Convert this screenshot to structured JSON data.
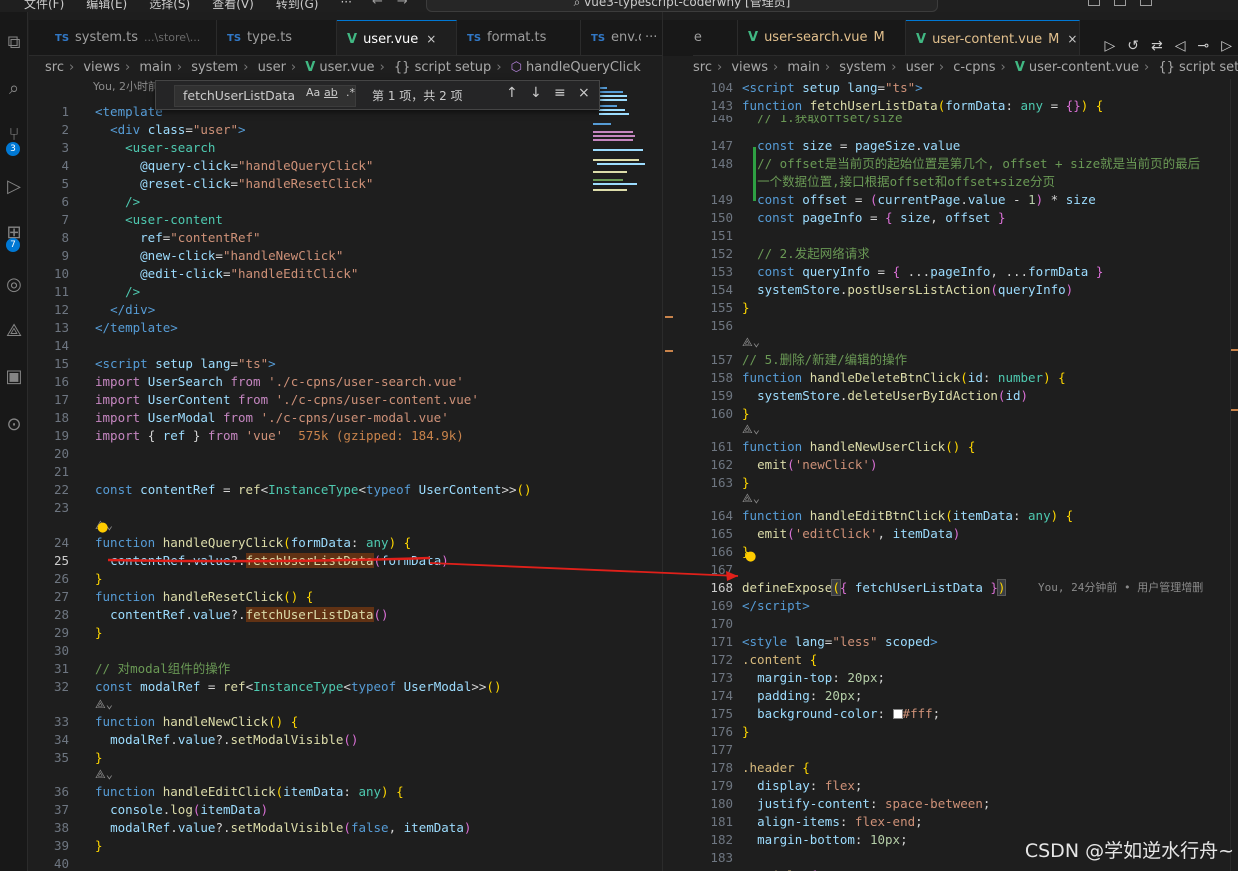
{
  "titlebar": {
    "menu": [
      "文件(F)",
      "编辑(E)",
      "选择(S)",
      "查看(V)",
      "转到(G)",
      "···"
    ],
    "command_center": "vue3-typescript-coderwhy [管理员]"
  },
  "left": {
    "tabs": [
      {
        "icon": "TS",
        "label": "system.ts",
        "hint": "...\\store\\..."
      },
      {
        "icon": "TS",
        "label": "type.ts"
      },
      {
        "icon": "V",
        "label": "user.vue",
        "close": "×",
        "active": true
      },
      {
        "icon": "TS",
        "label": "format.ts"
      },
      {
        "icon": "TS",
        "label": "env.d"
      },
      {
        "icon": "",
        "label": "···"
      }
    ],
    "breadcrumbs": [
      "src",
      "views",
      "main",
      "system",
      "user",
      "user.vue",
      "{} script setup",
      "handleQueryClick"
    ],
    "blame_top": "You, 2小时前",
    "find": {
      "query": "fetchUserListData",
      "opts": [
        "Aa",
        "ab",
        ".*"
      ],
      "result": "第 1 项，共 2 项",
      "buttons": [
        "↑",
        "↓",
        "≡",
        "×"
      ]
    },
    "import_size_hint": "575k (gzipped: 184.9k)"
  },
  "right": {
    "tabs": [
      {
        "icon": "",
        "label": "vue"
      },
      {
        "icon": "V",
        "label": "user-search.vue",
        "mod": "M"
      },
      {
        "icon": "V",
        "label": "user-content.vue",
        "mod": "M",
        "close": "×",
        "active": true
      }
    ],
    "breadcrumbs": [
      "src",
      "views",
      "main",
      "system",
      "user",
      "c-cpns",
      "user-content.vue",
      "{} script setup"
    ],
    "blame_line": "You, 24分钟前 • 用户管理增删"
  },
  "watermark": "CSDN @学如逆水行舟~",
  "colors": {
    "accent": "#0078d4",
    "annotation": "#e0201a"
  }
}
